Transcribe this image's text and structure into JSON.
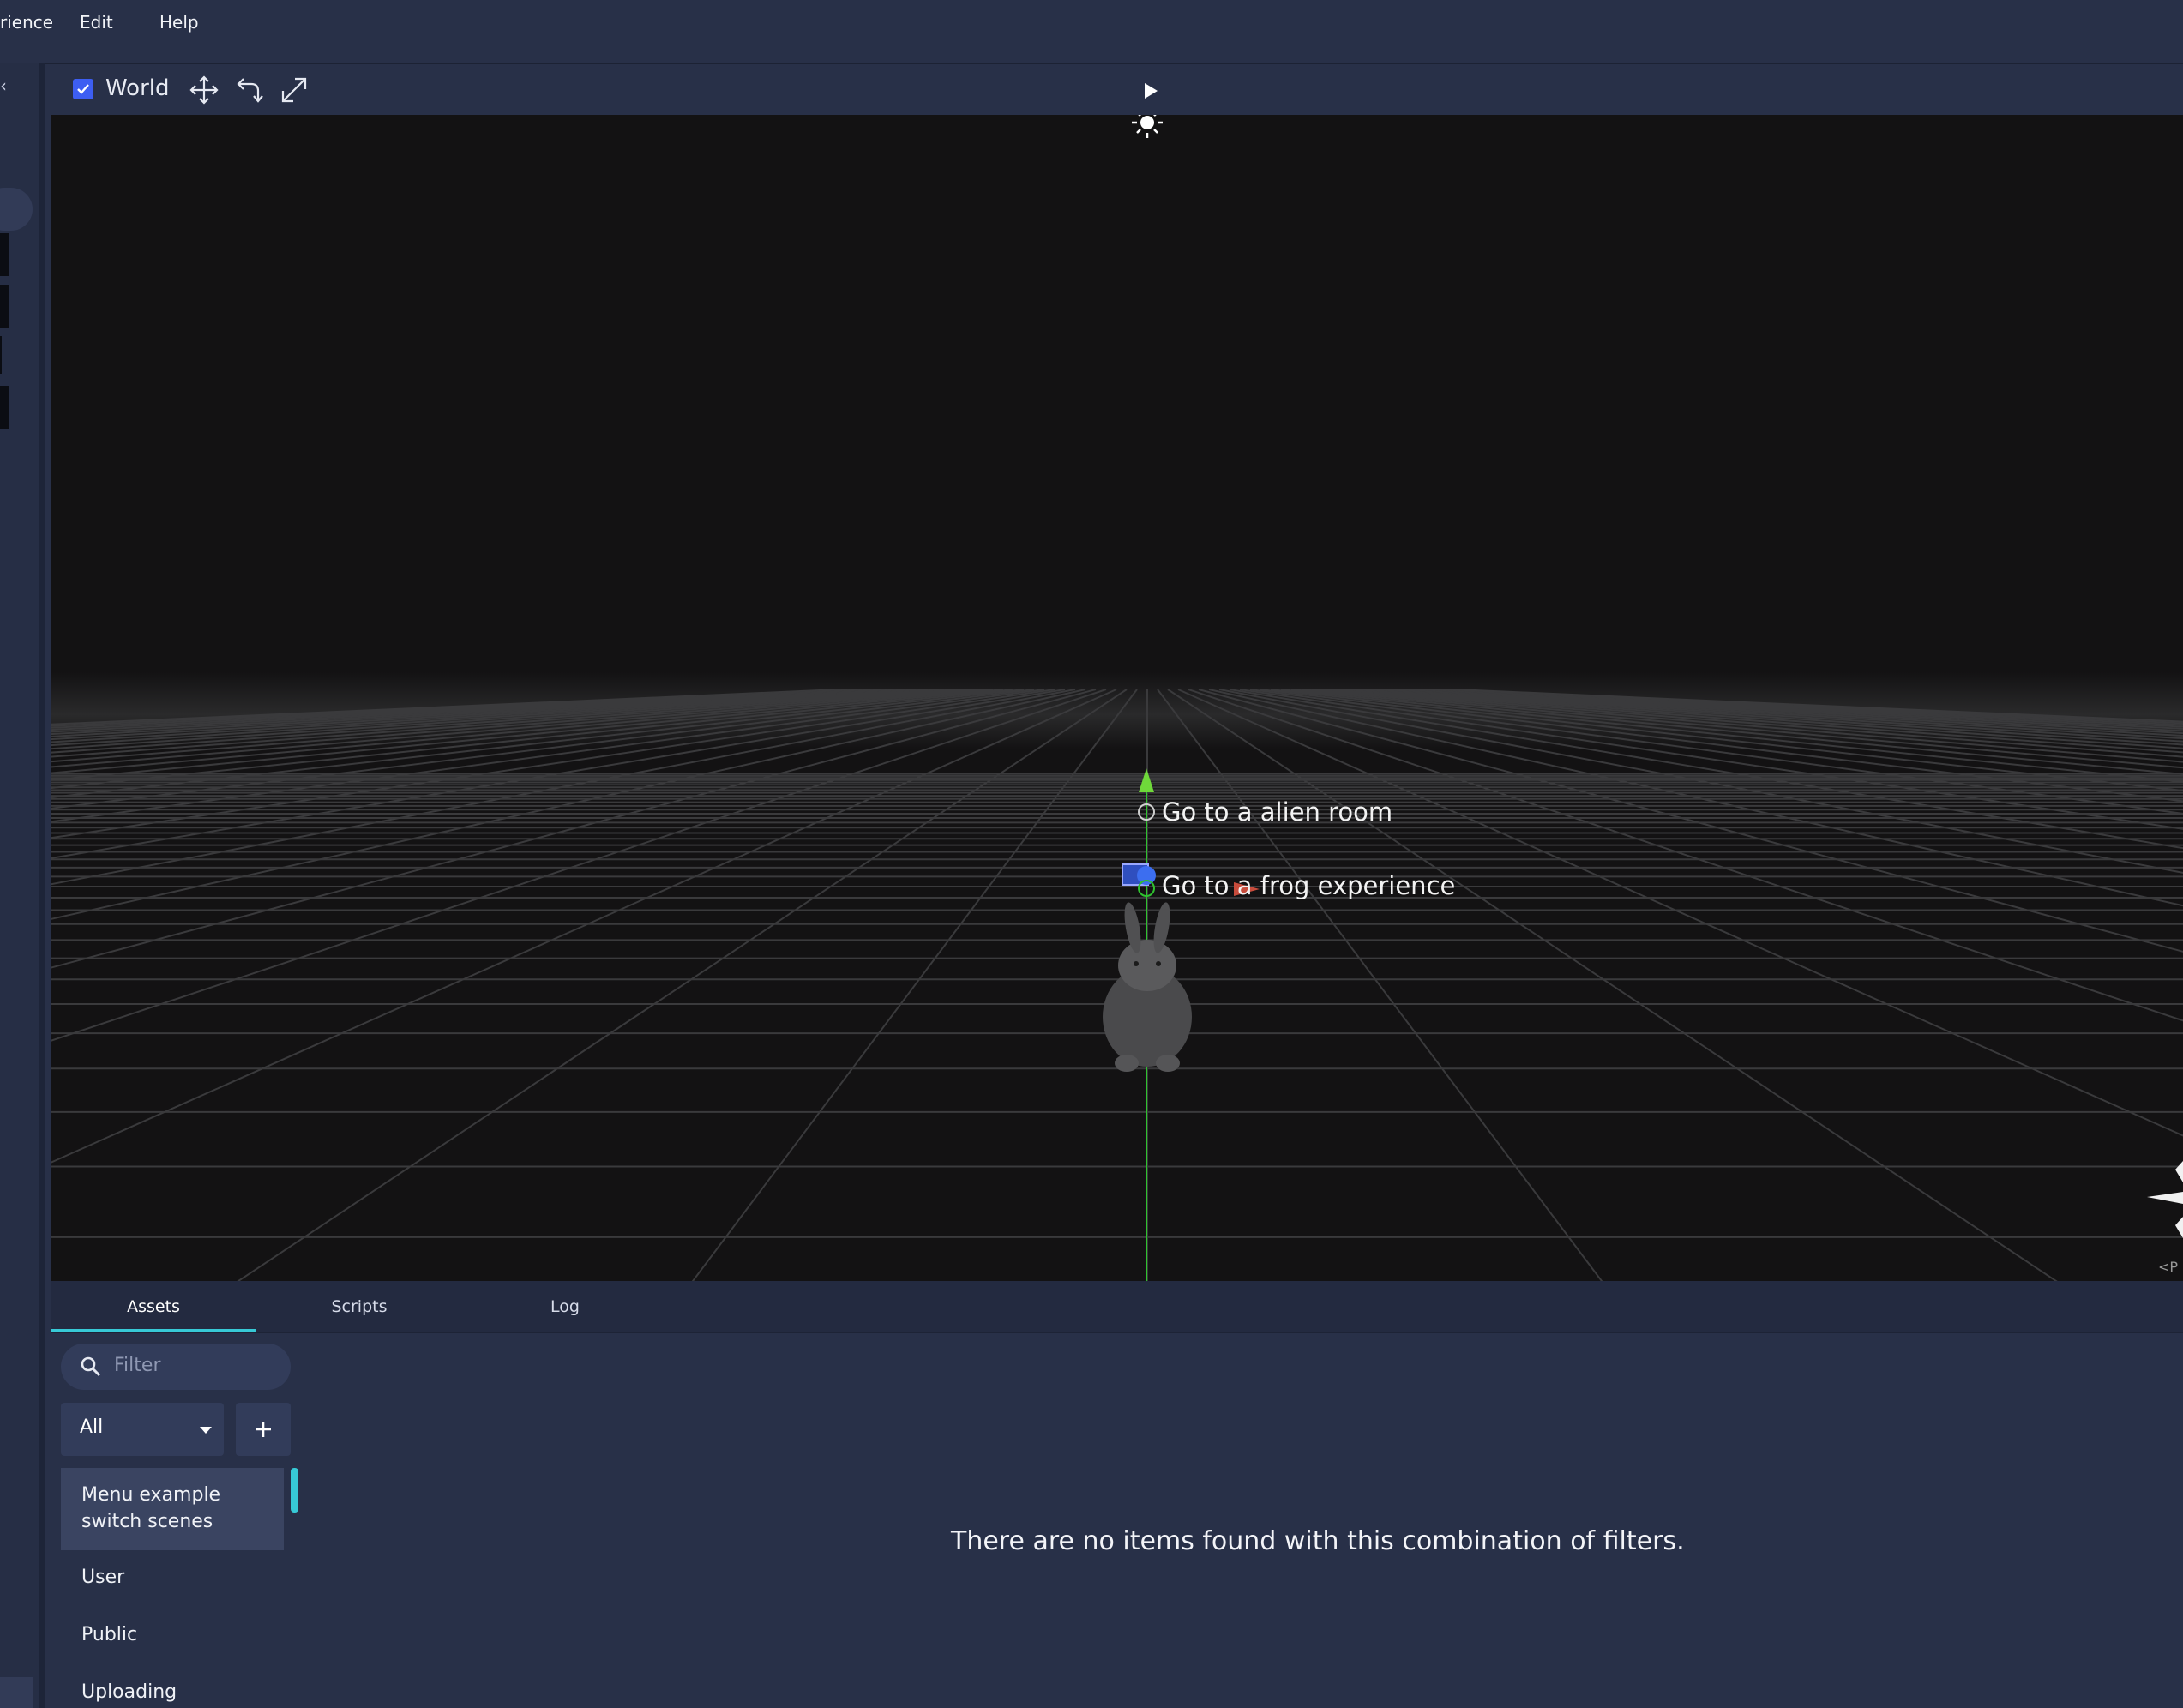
{
  "menubar": {
    "items": [
      "rience",
      "Edit",
      "Help"
    ]
  },
  "viewport_toolbar": {
    "world_checked": true,
    "world_label": "World",
    "icons": [
      "move-icon",
      "rotate-icon",
      "scale-icon",
      "play-icon"
    ]
  },
  "viewport": {
    "labels": [
      "Go to a alien room",
      "Go to a frog experience"
    ],
    "objects": [
      "sun-light-icon",
      "bunny-model",
      "ground-grid",
      "y-axis-gizmo",
      "orientation-gizmo"
    ]
  },
  "bottom_panel": {
    "tabs": [
      "Assets",
      "Scripts",
      "Log"
    ],
    "active_tab": "Assets",
    "filter_placeholder": "Filter",
    "type_select": "All",
    "folders": [
      "Menu example switch scenes",
      "User",
      "Public",
      "Uploading"
    ],
    "selected_folder": "Menu example switch scenes",
    "empty_message": "There are no items found with this combination of filters."
  },
  "colors": {
    "accent": "#37c9d6",
    "checkbox": "#3d5ef2",
    "panel": "#283048",
    "viewport": "#131213",
    "axis_green": "#2fc22f"
  }
}
